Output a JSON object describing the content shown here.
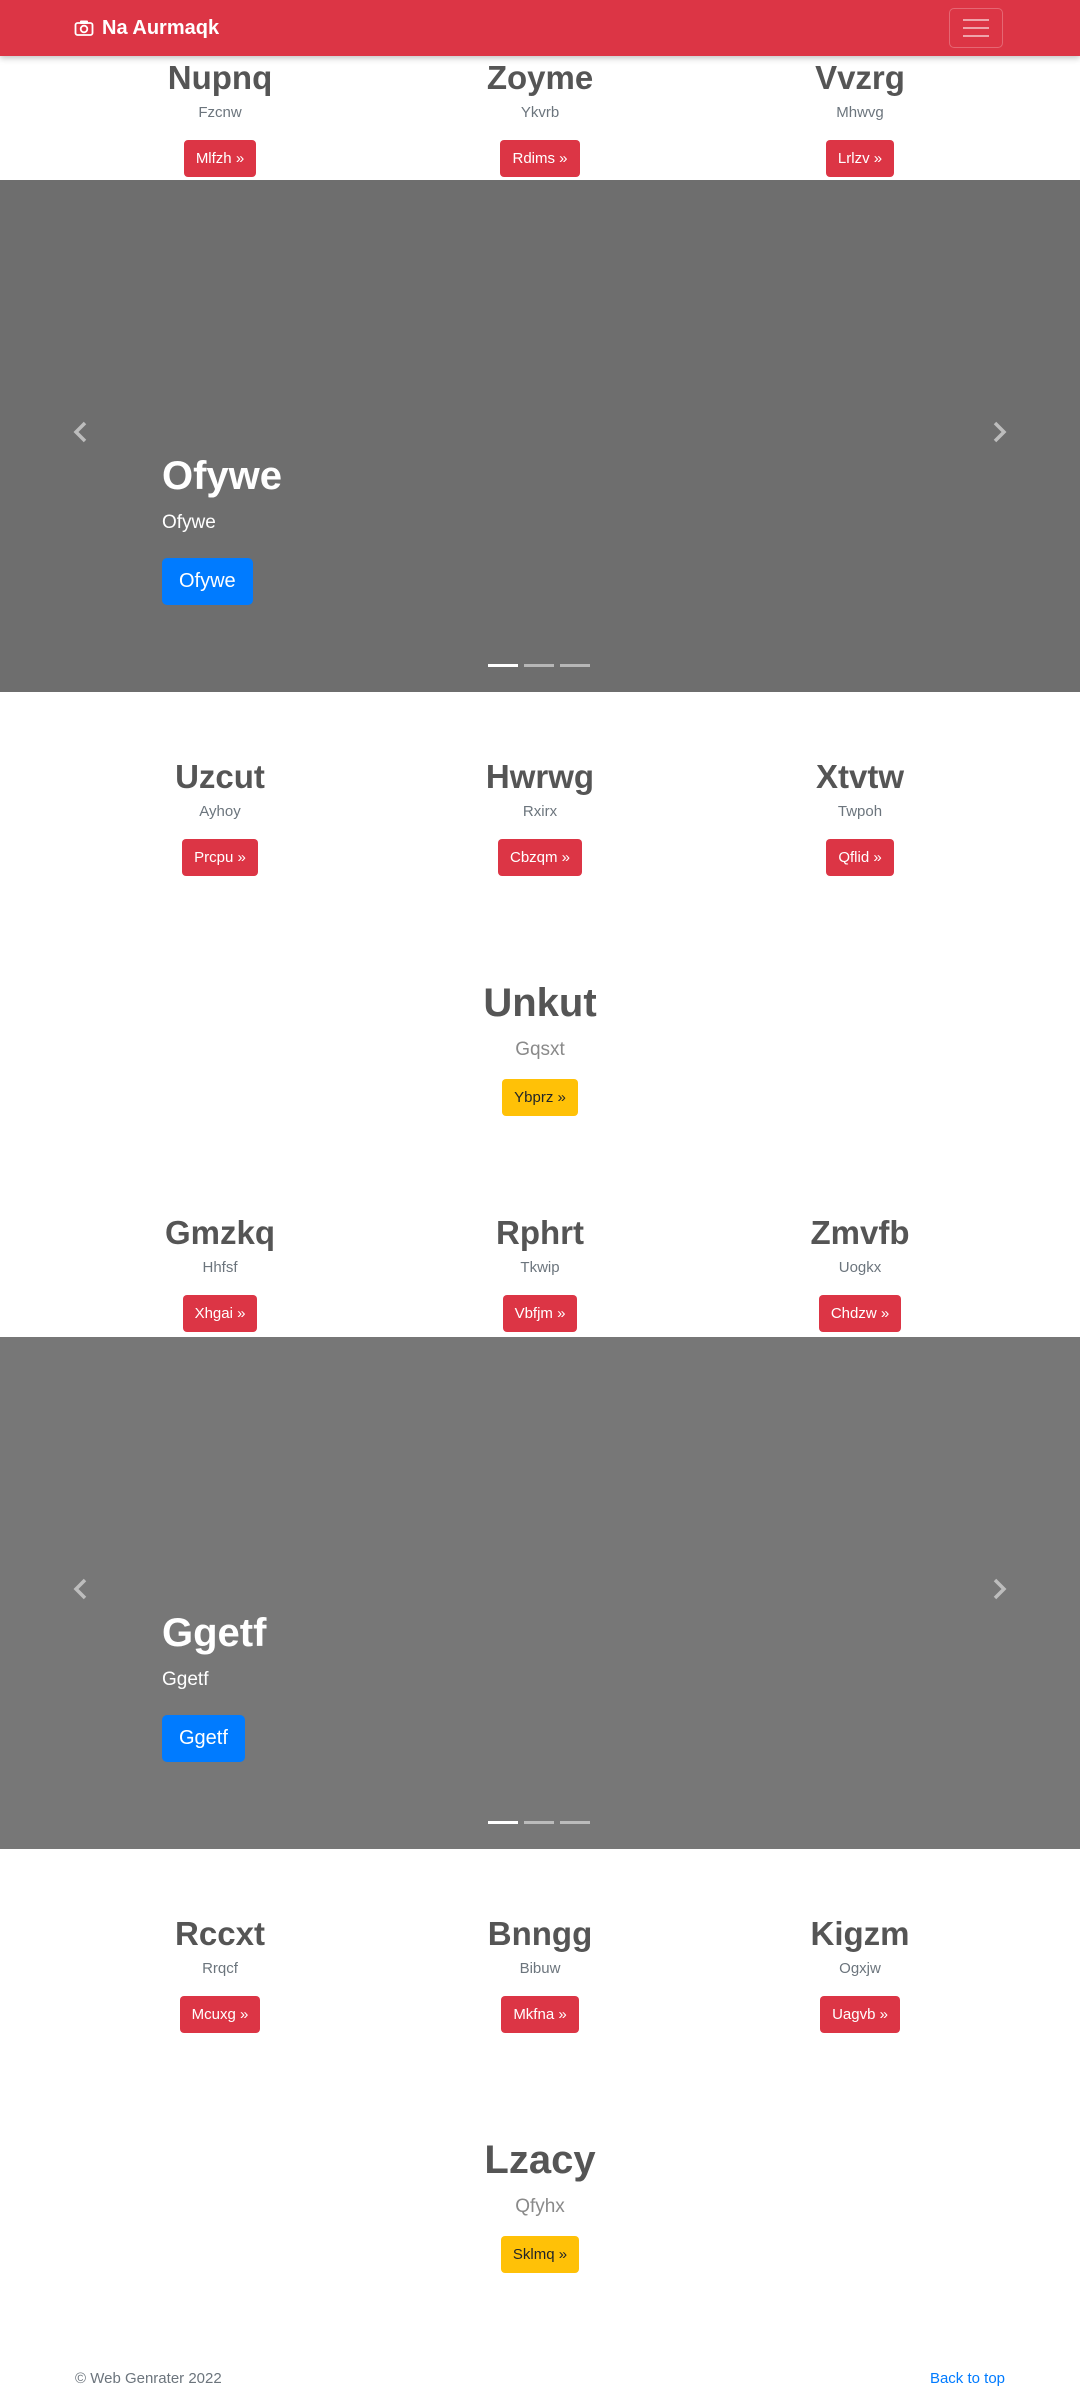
{
  "navbar": {
    "brand": "Na Aurmaqk",
    "icon": "camera-icon",
    "menu_icon": "hamburger-menu-icon",
    "color": "#dc3545"
  },
  "rows": [
    {
      "items": [
        {
          "title": "Nupnq",
          "subtitle": "Fzcnw",
          "button": "Mlfzh »"
        },
        {
          "title": "Zoyme",
          "subtitle": "Ykvrb",
          "button": "Rdims »"
        },
        {
          "title": "Vvzrg",
          "subtitle": "Mhwvg",
          "button": "Lrlzv »"
        }
      ]
    },
    {
      "items": [
        {
          "title": "Uzcut",
          "subtitle": "Ayhoy",
          "button": "Prcpu »"
        },
        {
          "title": "Hwrwg",
          "subtitle": "Rxirx",
          "button": "Cbzqm »"
        },
        {
          "title": "Xtvtw",
          "subtitle": "Twpoh",
          "button": "Qflid »"
        }
      ]
    },
    {
      "items": [
        {
          "title": "Gmzkq",
          "subtitle": "Hhfsf",
          "button": "Xhgai »"
        },
        {
          "title": "Rphrt",
          "subtitle": "Tkwip",
          "button": "Vbfjm »"
        },
        {
          "title": "Zmvfb",
          "subtitle": "Uogkx",
          "button": "Chdzw »"
        }
      ]
    },
    {
      "items": [
        {
          "title": "Rccxt",
          "subtitle": "Rrqcf",
          "button": "Mcuxg »"
        },
        {
          "title": "Bnngg",
          "subtitle": "Bibuw",
          "button": "Mkfna »"
        },
        {
          "title": "Kigzm",
          "subtitle": "Ogxjw",
          "button": "Uagvb »"
        }
      ]
    }
  ],
  "carousels": [
    {
      "title": "Ofywe",
      "subtitle": "Ofywe",
      "button": "Ofywe",
      "background": "#6e6e6e",
      "slides": 3,
      "active": 1
    },
    {
      "title": "Ggetf",
      "subtitle": "Ggetf",
      "button": "Ggetf",
      "background": "#777777",
      "slides": 3,
      "active": 1
    }
  ],
  "features": [
    {
      "title": "Unkut",
      "subtitle": "Gqsxt",
      "button": "Ybprz »"
    },
    {
      "title": "Lzacy",
      "subtitle": "Qfyhx",
      "button": "Sklmq »"
    }
  ],
  "footer": {
    "copyright": "© Web Genrater 2022",
    "back_to_top": "Back to top"
  }
}
